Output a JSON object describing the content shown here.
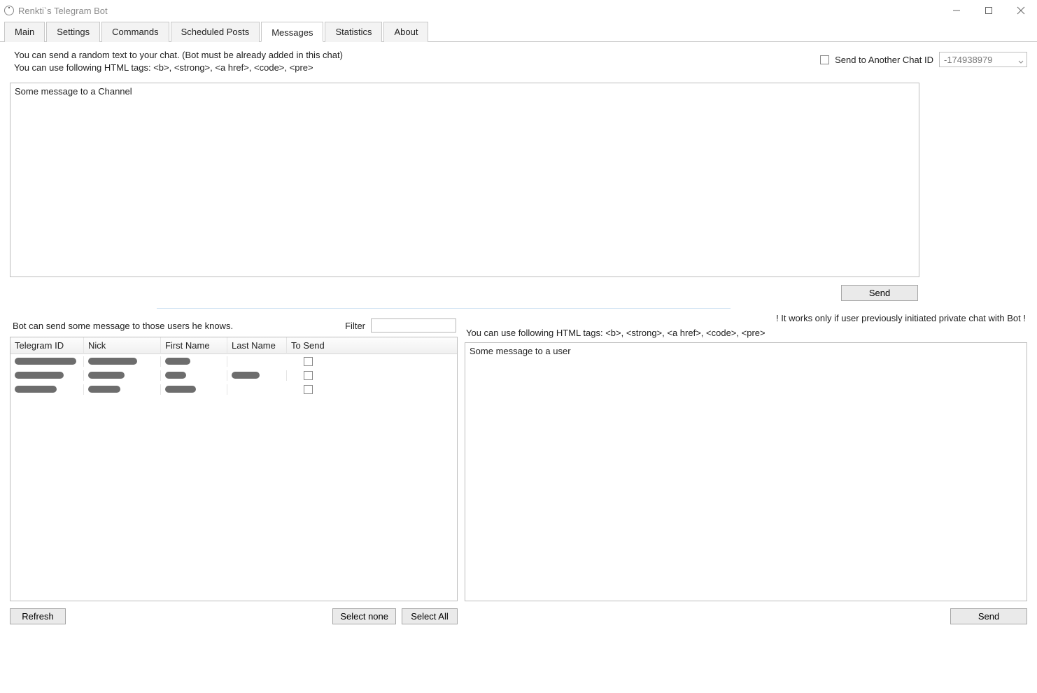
{
  "window": {
    "title": "Renkti`s Telegram Bot"
  },
  "tabs": {
    "items": [
      "Main",
      "Settings",
      "Commands",
      "Scheduled Posts",
      "Messages",
      "Statistics",
      "About"
    ],
    "active": "Messages"
  },
  "upper": {
    "info_line1": "You can send a random text to your chat.   (Bot must be already added in this chat)",
    "info_line2": "You can use following HTML tags:   <b>, <strong>, <a href>, <code>, <pre>",
    "send_other_label": "Send to Another Chat ID",
    "chat_id_value": "-174938979",
    "message_text": "Some message to a Channel",
    "send_button": "Send"
  },
  "lower_left": {
    "info": "Bot can send some message to those users he knows.",
    "filter_label": "Filter",
    "filter_value": "",
    "columns": [
      "Telegram ID",
      "Nick",
      "First Name",
      "Last Name",
      "To Send"
    ],
    "rows": [
      {
        "id": "redacted",
        "nick": "redacted",
        "first": "redacted",
        "last": "",
        "send": false
      },
      {
        "id": "redacted",
        "nick": "redacted",
        "first": "redacted",
        "last": "redacted",
        "send": false
      },
      {
        "id": "redacted",
        "nick": "redacted",
        "first": "redacted",
        "last": "",
        "send": false
      }
    ],
    "refresh_button": "Refresh",
    "select_none_button": "Select none",
    "select_all_button": "Select All"
  },
  "lower_right": {
    "warn": "! It works only if user previously initiated private chat with Bot !",
    "info": "You can use following HTML tags:   <b>, <strong>, <a href>, <code>, <pre>",
    "message_text": "Some message to a user",
    "send_button": "Send"
  }
}
